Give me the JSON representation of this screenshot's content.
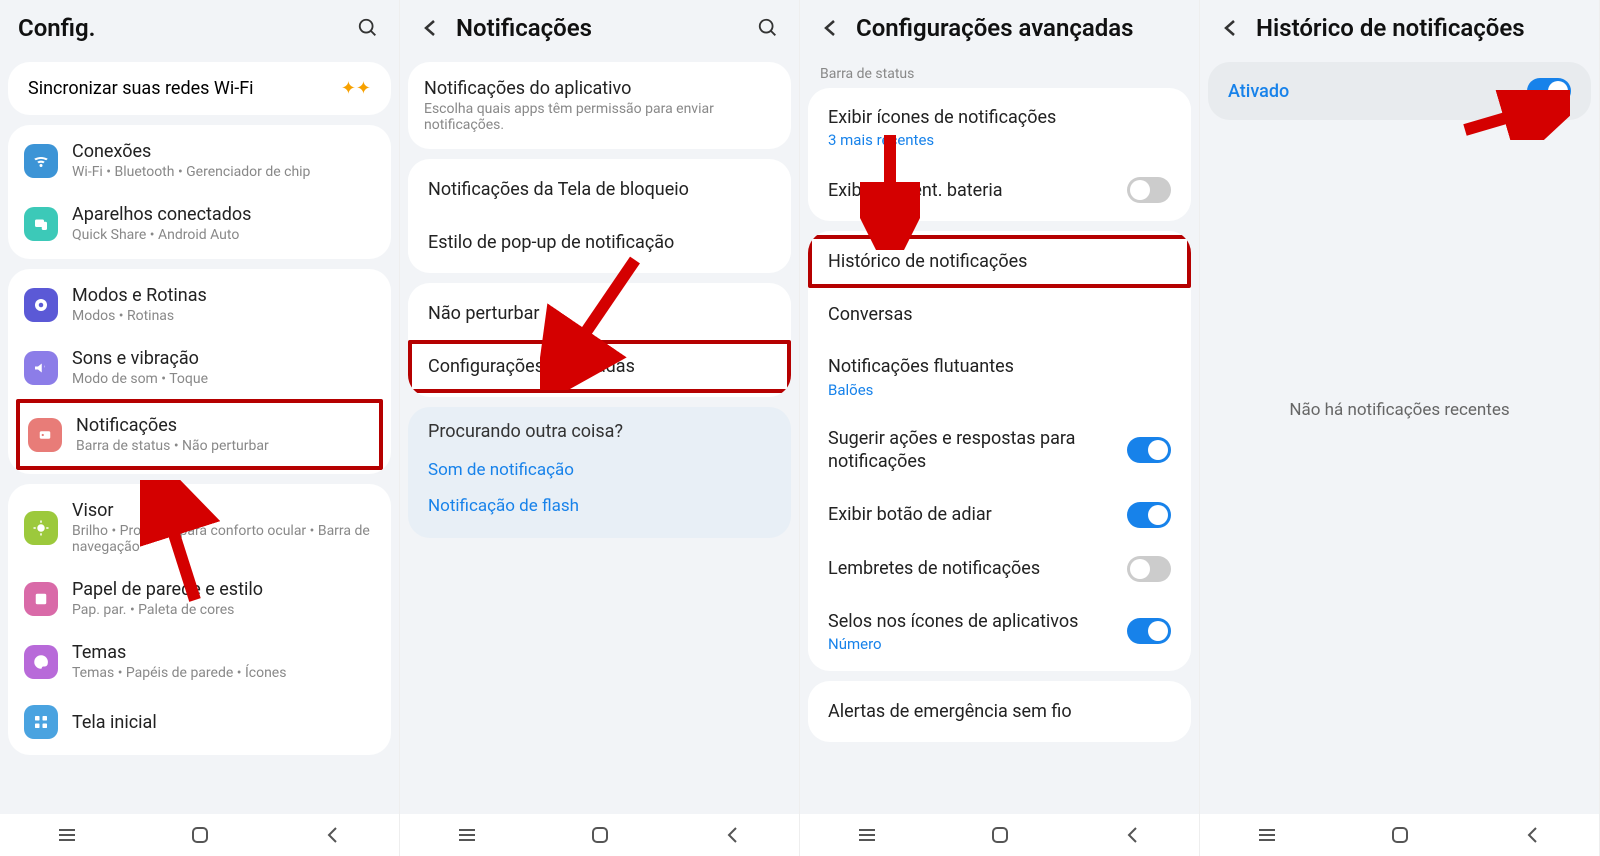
{
  "panel1": {
    "title": "Config.",
    "wifi_sync": "Sincronizar suas redes Wi-Fi",
    "rows": {
      "connections": {
        "label": "Conexões",
        "sub": "Wi-Fi • Bluetooth • Gerenciador de chip"
      },
      "devices": {
        "label": "Aparelhos conectados",
        "sub": "Quick Share • Android Auto"
      },
      "modes": {
        "label": "Modos e Rotinas",
        "sub": "Modos • Rotinas"
      },
      "sound": {
        "label": "Sons e vibração",
        "sub": "Modo de som • Toque"
      },
      "notifications": {
        "label": "Notificações",
        "sub": "Barra de status • Não perturbar"
      },
      "display": {
        "label": "Visor",
        "sub": "Brilho • Proteção para conforto ocular • Barra de navegação"
      },
      "wallpaper": {
        "label": "Papel de parede e estilo",
        "sub": "Pap. par. • Paleta de cores"
      },
      "themes": {
        "label": "Temas",
        "sub": "Temas • Papéis de parede • Ícones"
      },
      "home": {
        "label": "Tela inicial"
      }
    }
  },
  "panel2": {
    "title": "Notificações",
    "app_notif": {
      "label": "Notificações do aplicativo",
      "sub": "Escolha quais apps têm permissão para enviar notificações."
    },
    "lockscreen": "Notificações da Tela de bloqueio",
    "popup": "Estilo de pop-up de notificação",
    "dnd": "Não perturbar",
    "advanced": "Configurações avançadas",
    "suggestion": {
      "title": "Procurando outra coisa?",
      "link1": "Som de notificação",
      "link2": "Notificação de flash"
    }
  },
  "panel3": {
    "title": "Configurações avançadas",
    "section_status": "Barra de status",
    "show_icons": {
      "label": "Exibir ícones de notificações",
      "sub": "3 mais recentes"
    },
    "battery_pct": "Exibir porcent. bateria",
    "history": "Histórico de notificações",
    "conversations": "Conversas",
    "floating": {
      "label": "Notificações flutuantes",
      "sub": "Balões"
    },
    "suggest": "Sugerir ações e respostas para notificações",
    "snooze": "Exibir botão de adiar",
    "reminders": "Lembretes de notificações",
    "badges": {
      "label": "Selos nos ícones de aplicativos",
      "sub": "Número"
    },
    "emergency": "Alertas de emergência sem fio"
  },
  "panel4": {
    "title": "Histórico de notificações",
    "activated": "Ativado",
    "empty": "Não há notificações recentes"
  }
}
